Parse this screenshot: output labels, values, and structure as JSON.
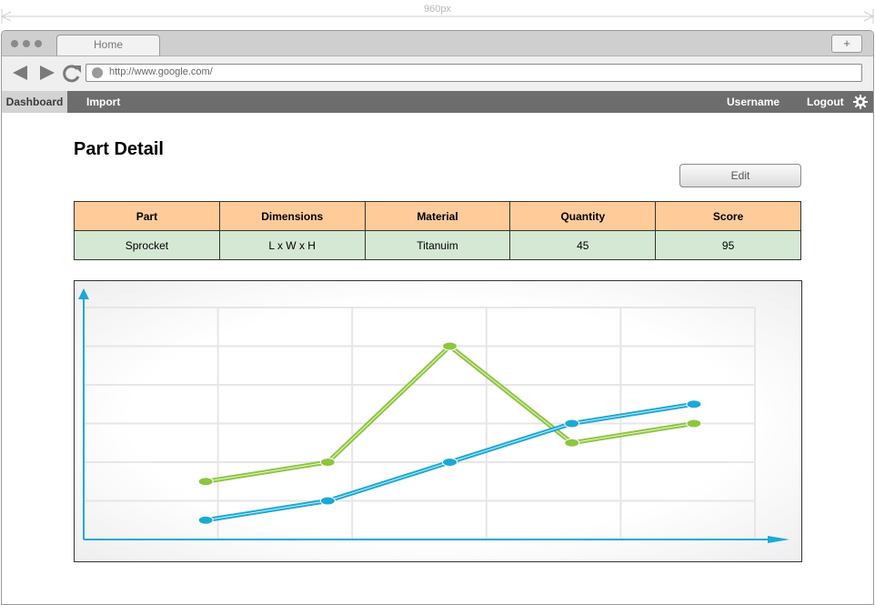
{
  "ruler": {
    "label": "960px"
  },
  "browser": {
    "tab_title": "Home",
    "new_tab_label": "+",
    "url": "http://www.google.com/"
  },
  "nav": {
    "dashboard": "Dashboard",
    "import": "Import",
    "username": "Username",
    "logout": "Logout"
  },
  "page": {
    "title": "Part Detail",
    "edit_label": "Edit"
  },
  "table": {
    "headers": [
      "Part",
      "Dimensions",
      "Material",
      "Quantity",
      "Score"
    ],
    "row": [
      "Sprocket",
      "L x W x H",
      "Titanuim",
      "45",
      "95"
    ]
  },
  "colors": {
    "header_bg": "#ffcc99",
    "row_bg": "#d5e8d4",
    "nav_bg": "#6d6d6d",
    "green_series": "#8dc63f",
    "blue_series": "#1ca9d6",
    "axis": "#1ca9d6"
  },
  "chart_data": {
    "type": "line",
    "x": [
      1,
      2,
      3,
      4,
      5
    ],
    "ylim": [
      0,
      6
    ],
    "xlim": [
      0,
      5.5
    ],
    "grid": true,
    "series": [
      {
        "values": [
          1.5,
          2.0,
          5.0,
          2.5,
          3.0
        ]
      },
      {
        "values": [
          0.5,
          1.0,
          2.0,
          3.0,
          3.5
        ]
      }
    ]
  }
}
